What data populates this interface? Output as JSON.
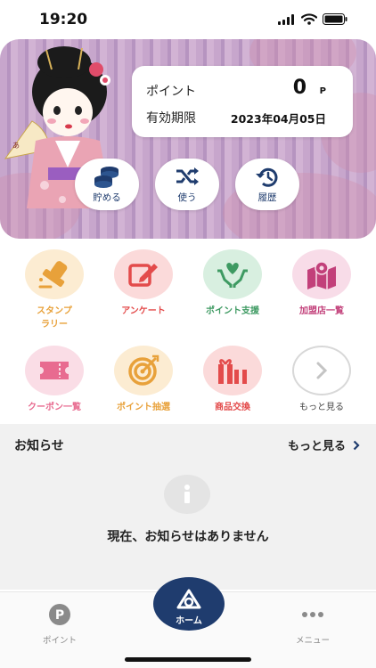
{
  "status_bar": {
    "time": "19:20"
  },
  "points_card": {
    "points_label": "ポイント",
    "points_value": "0",
    "points_unit": "P",
    "expiry_label": "有効期限",
    "expiry_date": "2023年04月05日"
  },
  "hero_buttons": {
    "save_label": "貯める",
    "use_label": "使う",
    "history_label": "履歴"
  },
  "menu": {
    "stamp_label": "スタンプ\nラリー",
    "survey_label": "アンケート",
    "support_label": "ポイント支援",
    "stores_label": "加盟店一覧",
    "coupons_label": "クーポン一覧",
    "lottery_label": "ポイント抽選",
    "exchange_label": "商品交換",
    "more_label": "もっと見る"
  },
  "news": {
    "title": "お知らせ",
    "more_label": "もっと見る",
    "empty_message": "現在、お知らせはありません"
  },
  "tabbar": {
    "points_label": "ポイント",
    "home_label": "ホーム",
    "menu_label": "メニュー"
  },
  "colors": {
    "navy": "#1f3c6e",
    "orange": "#e8a13a",
    "red": "#e34b4b",
    "green": "#3e9a62",
    "pink": "#c2407a"
  },
  "icons": [
    "coins-icon",
    "shuffle-icon",
    "history-icon",
    "stamp-icon",
    "survey-edit-icon",
    "heart-hands-icon",
    "map-pin-icon",
    "ticket-icon",
    "target-icon",
    "gift-icon",
    "chevron-right-icon",
    "info-icon",
    "point-p-icon",
    "home-icon",
    "dots-icon"
  ]
}
